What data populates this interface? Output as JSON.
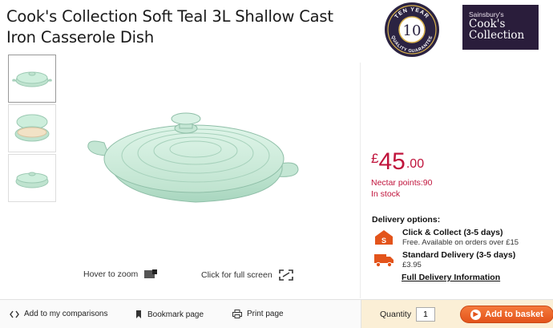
{
  "product": {
    "title": "Cook's Collection Soft Teal 3L Shallow Cast Iron Casserole Dish"
  },
  "badges": {
    "guarantee_top": "TEN YEAR",
    "guarantee_number": "10",
    "guarantee_bottom": "QUALITY GUARANTEE",
    "brand_small": "Sainsbury's",
    "brand_line1": "Cook's",
    "brand_line2": "Collection"
  },
  "gallery": {
    "thumbnails": [
      "thumb-lid-on",
      "thumb-open",
      "thumb-lid-on-side"
    ],
    "hover_zoom_label": "Hover to zoom",
    "full_screen_label": "Click for full screen"
  },
  "price": {
    "currency": "£",
    "pounds": "45",
    "pence": ".00",
    "nectar": "Nectar points:90",
    "stock": "In stock"
  },
  "delivery": {
    "heading": "Delivery options:",
    "click_collect_title": "Click & Collect (3-5 days)",
    "click_collect_sub": "Free. Available on orders over £15",
    "standard_title": "Standard Delivery (3-5 days)",
    "standard_price": "£3.95",
    "full_info_link": "Full Delivery Information"
  },
  "actions": {
    "compare": "Add to my comparisons",
    "bookmark": "Bookmark page",
    "print": "Print page"
  },
  "basket": {
    "quantity_label": "Quantity",
    "quantity_value": "1",
    "add_button": "Add to basket"
  },
  "colors": {
    "price_red": "#c0143c",
    "accent_orange": "#e3541b",
    "product_teal": "#bfe3cf",
    "brand_purple": "#2a1d3b",
    "basket_bar_bg": "#fbefd6"
  }
}
